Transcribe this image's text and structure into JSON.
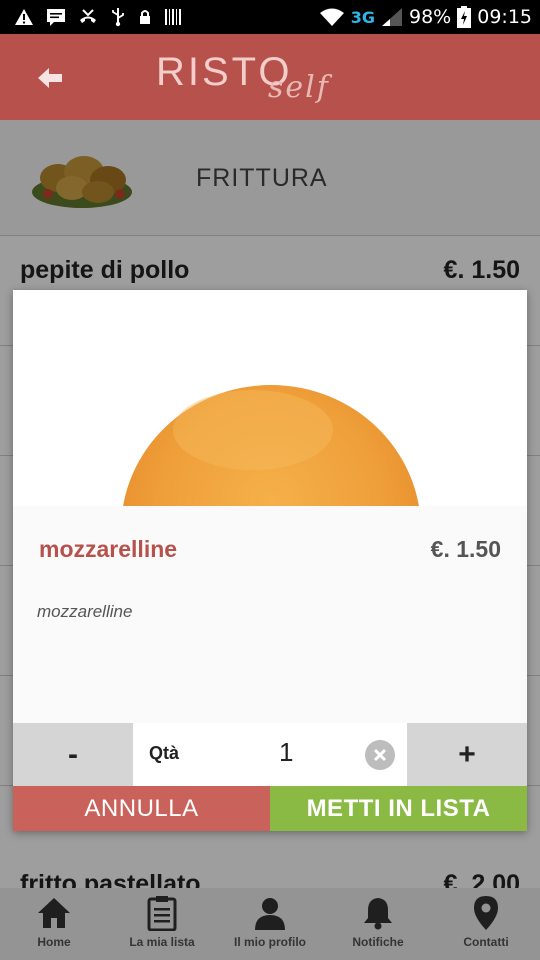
{
  "status_bar": {
    "network": "3G",
    "battery": "98%",
    "time": "09:15"
  },
  "header": {
    "logo_main": "RISTO",
    "logo_script": "self"
  },
  "category": {
    "title": "FRITTURA"
  },
  "list": {
    "items": [
      {
        "name": "pepite di pollo",
        "price": "€. 1.50"
      },
      {
        "name": "fritto pastellato",
        "price": "€. 2.00"
      }
    ]
  },
  "dialog": {
    "name": "mozzarelline",
    "price": "€. 1.50",
    "description": "mozzarelline",
    "qty_label": "Qtà",
    "qty_value": "1",
    "minus_label": "-",
    "plus_label": "+",
    "cancel_label": "ANNULLA",
    "add_label": "METTI IN LISTA"
  },
  "bottom_nav": [
    {
      "label": "Home",
      "icon": "home-icon"
    },
    {
      "label": "La mia lista",
      "icon": "clipboard-icon"
    },
    {
      "label": "Il mio profilo",
      "icon": "user-icon"
    },
    {
      "label": "Notifiche",
      "icon": "bell-icon"
    },
    {
      "label": "Contatti",
      "icon": "location-pin-icon"
    }
  ],
  "colors": {
    "brand": "#b7514c",
    "cancel": "#c9625b",
    "add": "#8ab944"
  }
}
